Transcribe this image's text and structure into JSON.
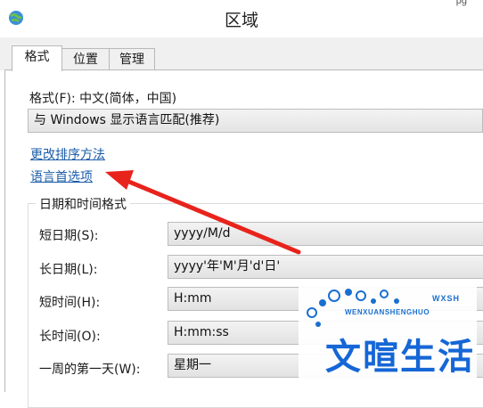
{
  "window": {
    "title": "区域",
    "top_glimpse": "pg"
  },
  "tabs": [
    {
      "label": "格式",
      "active": true
    },
    {
      "label": "位置",
      "active": false
    },
    {
      "label": "管理",
      "active": false
    }
  ],
  "format": {
    "label": "格式(F): 中文(简体，中国)",
    "selected": "与 Windows 显示语言匹配(推荐)"
  },
  "links": {
    "change_sort": "更改排序方法",
    "language_prefs": "语言首选项"
  },
  "datetime": {
    "legend": "日期和时间格式",
    "rows": [
      {
        "label": "短日期(S):",
        "value": "yyyy/M/d"
      },
      {
        "label": "长日期(L):",
        "value": "yyyy'年'M'月'd'日'"
      },
      {
        "label": "短时间(H):",
        "value": "H:mm"
      },
      {
        "label": "长时间(O):",
        "value": "H:mm:ss"
      },
      {
        "label": "一周的第一天(W):",
        "value": "星期一"
      }
    ]
  },
  "watermark": {
    "main": "文暄生活",
    "sub": "WENXUANSHENGHUO",
    "abbr": "WXSH"
  },
  "colors": {
    "link": "#1a5ca8",
    "arrow": "#e8231c",
    "watermark": "#1566d6"
  }
}
